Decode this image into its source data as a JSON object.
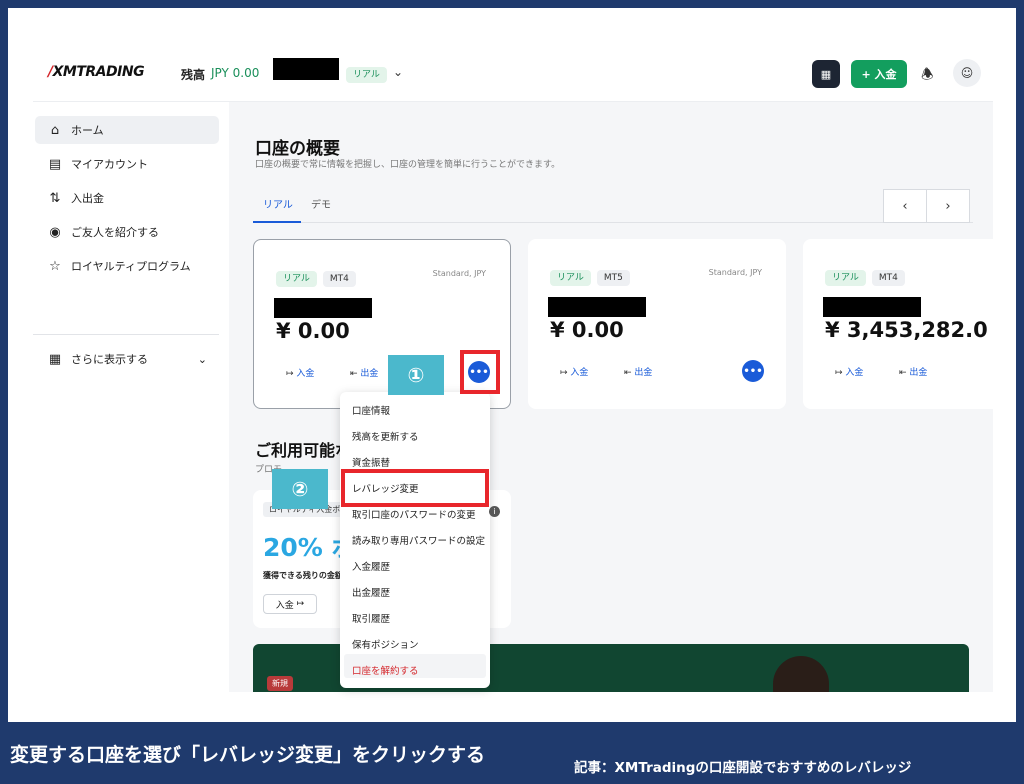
{
  "header": {
    "logo": "XMTRADING",
    "balance_label": "残高",
    "balance_value": "JPY 0.00",
    "account_tag": "リアル",
    "deposit_label": "+ 入金"
  },
  "sidebar": {
    "items": [
      {
        "label": "ホーム"
      },
      {
        "label": "マイアカウント"
      },
      {
        "label": "入出金"
      },
      {
        "label": "ご友人を紹介する"
      },
      {
        "label": "ロイヤルティプログラム"
      }
    ],
    "more_label": "さらに表示する"
  },
  "main": {
    "title": "口座の概要",
    "subtitle": "口座の概要で常に情報を把握し、口座の管理を簡単に行うことができます。",
    "tabs": [
      {
        "label": "リアル"
      },
      {
        "label": "デモ"
      }
    ],
    "cards": [
      {
        "tag": "リアル",
        "platform": "MT4",
        "type": "Standard, JPY",
        "balance": "¥ 0.00",
        "deposit": "入金",
        "withdraw": "出金"
      },
      {
        "tag": "リアル",
        "platform": "MT5",
        "type": "Standard, JPY",
        "balance": "¥ 0.00",
        "deposit": "入金",
        "withdraw": "出金"
      },
      {
        "tag": "リアル",
        "platform": "MT4",
        "type": "",
        "balance": "¥ 3,453,282.0",
        "deposit": "入金",
        "withdraw": "出金"
      }
    ],
    "section_title": "ご利用可能な",
    "section_title_tail": "ス",
    "section_subtitle": "プロモ",
    "promo": {
      "tag": "ロイヤルティ入金ボ",
      "big": "20% ボ",
      "small": "獲得できる残りの金額",
      "button": "入金"
    },
    "banner_new": "新規"
  },
  "menu": {
    "items": [
      {
        "label": "口座情報"
      },
      {
        "label": "残高を更新する"
      },
      {
        "label": "資金振替"
      },
      {
        "label": "レバレッジ変更"
      },
      {
        "label": "取引口座のパスワードの変更"
      },
      {
        "label": "読み取り専用パスワードの設定"
      },
      {
        "label": "入金履歴"
      },
      {
        "label": "出金履歴"
      },
      {
        "label": "取引履歴"
      },
      {
        "label": "保有ポジション"
      },
      {
        "label": "口座を解約する"
      }
    ]
  },
  "steps": {
    "one": "①",
    "two": "②"
  },
  "caption": "変更する口座を選び「レバレッジ変更」をクリックする",
  "source": "記事：XMTradingの口座開設でおすすめのレバレッジ",
  "colors": {
    "accent": "#1a5bd8",
    "brand_green": "#139e5e",
    "highlight": "#e8262b",
    "step_bg": "#4bb8cc",
    "caption_bg": "#1f3a6d"
  }
}
